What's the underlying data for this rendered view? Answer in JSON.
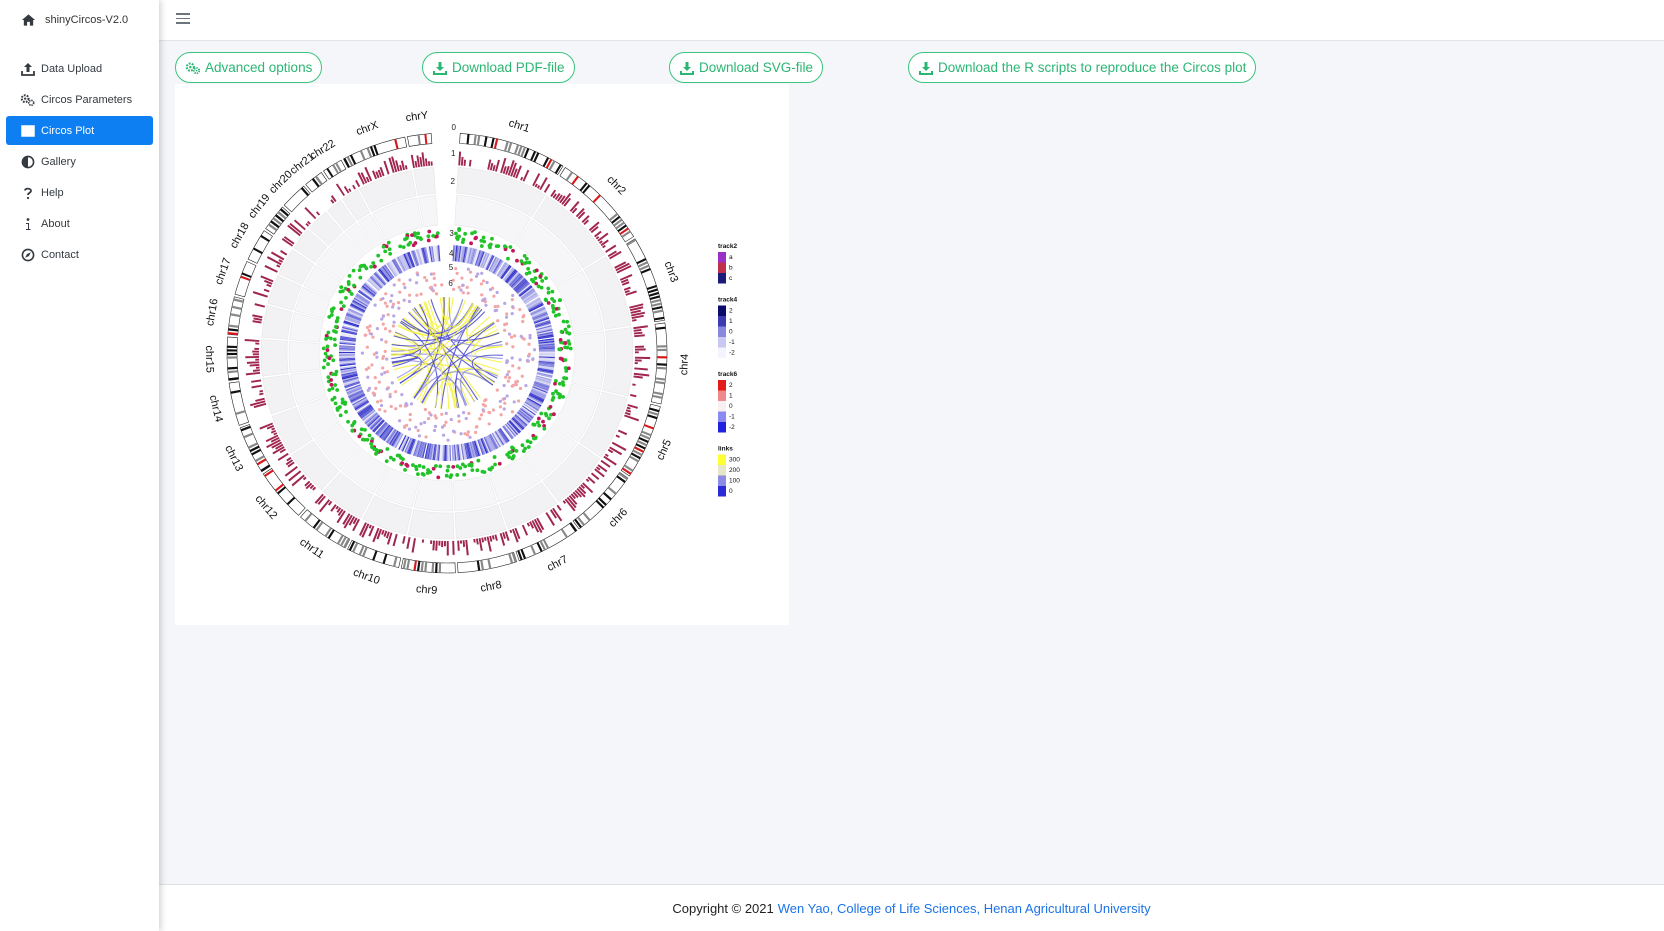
{
  "app": {
    "title": "shinyCircos-V2.0"
  },
  "sidebar": {
    "items": [
      {
        "label": "Data Upload",
        "icon": "upload-icon"
      },
      {
        "label": "Circos Parameters",
        "icon": "gears-icon"
      },
      {
        "label": "Circos Plot",
        "icon": "image-icon",
        "active": true
      },
      {
        "label": "Gallery",
        "icon": "half-circle-icon"
      },
      {
        "label": "Help",
        "icon": "question-icon"
      },
      {
        "label": "About",
        "icon": "info-icon"
      },
      {
        "label": "Contact",
        "icon": "compass-icon"
      }
    ]
  },
  "toolbar": {
    "advanced_label": "Advanced options",
    "pdf_label": "Download PDF-file",
    "svg_label": "Download SVG-file",
    "rscript_label": "Download the R scripts to reproduce the Circos plot"
  },
  "plot": {
    "chromosomes": [
      "chr1",
      "chr2",
      "chr3",
      "chr4",
      "chr5",
      "chr6",
      "chr7",
      "chr8",
      "chr9",
      "chr10",
      "chr11",
      "chr12",
      "chr13",
      "chr14",
      "chr15",
      "chr16",
      "chr17",
      "chr18",
      "chr19",
      "chr20",
      "chr21",
      "chr22",
      "chrX",
      "chrY"
    ],
    "track_numbers": [
      "0",
      "1",
      "2",
      "3",
      "4",
      "5",
      "6"
    ],
    "legends": [
      {
        "title": "track2",
        "entries": [
          "a",
          "b",
          "c"
        ],
        "colors": [
          "#9b30c8",
          "#c0304a",
          "#1b1b7a"
        ]
      },
      {
        "title": "track4",
        "entries": [
          "2",
          "1",
          "0",
          "-1",
          "-2"
        ],
        "colors": [
          "#0b0b6b",
          "#3c3cb0",
          "#8888dd",
          "#c8c8f0",
          "#f4f4ff"
        ]
      },
      {
        "title": "track6",
        "entries": [
          "2",
          "1",
          "0",
          "-1",
          "-2"
        ],
        "colors": [
          "#e31a1c",
          "#f08a8a",
          "#f6f0f0",
          "#8a8af0",
          "#2020e0"
        ]
      },
      {
        "title": "links",
        "entries": [
          "300",
          "200",
          "100",
          "0"
        ],
        "colors": [
          "#ffff33",
          "#e6e6c8",
          "#8c8ce6",
          "#2b2bd6"
        ]
      }
    ],
    "colors": {
      "bar": "#a0264f",
      "green": "#22c32a",
      "blue": "#3b3bd4",
      "yellow": "#f4f23a"
    }
  },
  "footer": {
    "copyright": "Copyright © 2021",
    "author": "Wen Yao, College of Life Sciences, Henan Agricultural University"
  }
}
